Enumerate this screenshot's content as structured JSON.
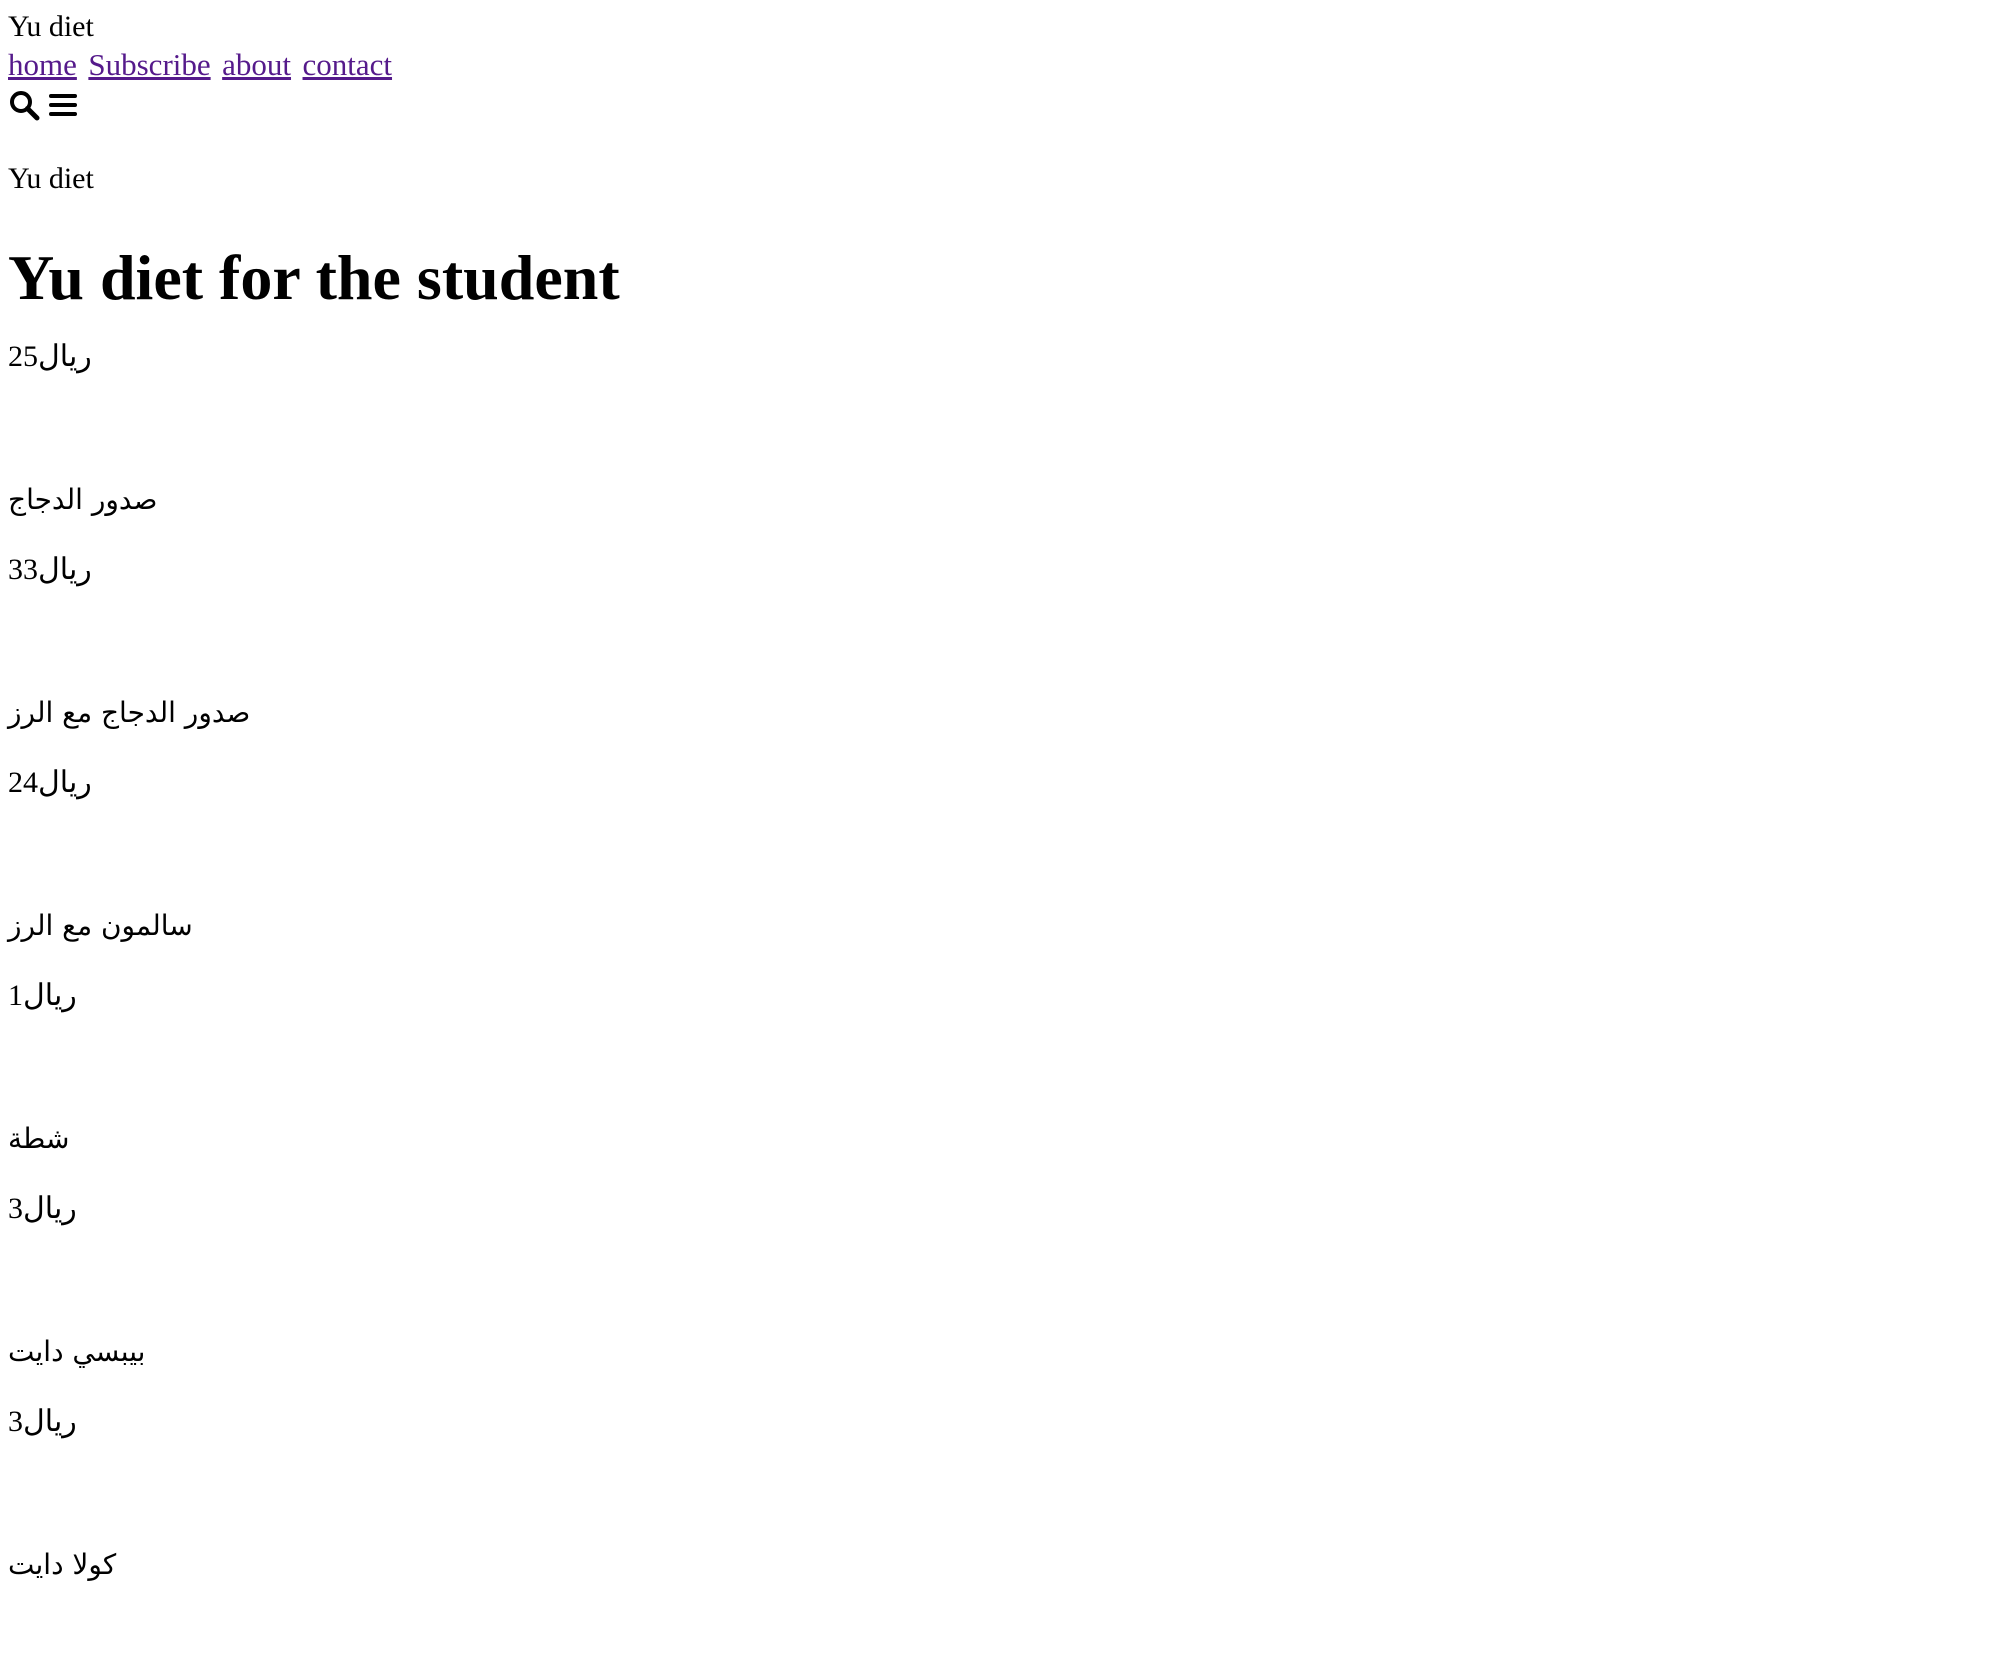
{
  "header": {
    "logo": "Yu diet",
    "nav": [
      "home",
      "Subscribe",
      "about",
      "contact"
    ],
    "icons": [
      "search-icon",
      "menu-icon"
    ]
  },
  "main": {
    "brand": "Yu diet",
    "title": "Yu diet for the student",
    "items": [
      {
        "price": "25ريال",
        "name": "صدور الدجاج"
      },
      {
        "price": "33ريال",
        "name": "صدور الدجاج مع الرز"
      },
      {
        "price": "24ريال",
        "name": "سالمون مع الرز"
      },
      {
        "price": "1ريال",
        "name": "شطة"
      },
      {
        "price": "3ريال",
        "name": "بيبسي دايت"
      },
      {
        "price": "3ريال",
        "name": "كولا دايت"
      }
    ]
  },
  "colors": {
    "link": "#551a8b",
    "text": "#000000",
    "background": "#ffffff"
  }
}
